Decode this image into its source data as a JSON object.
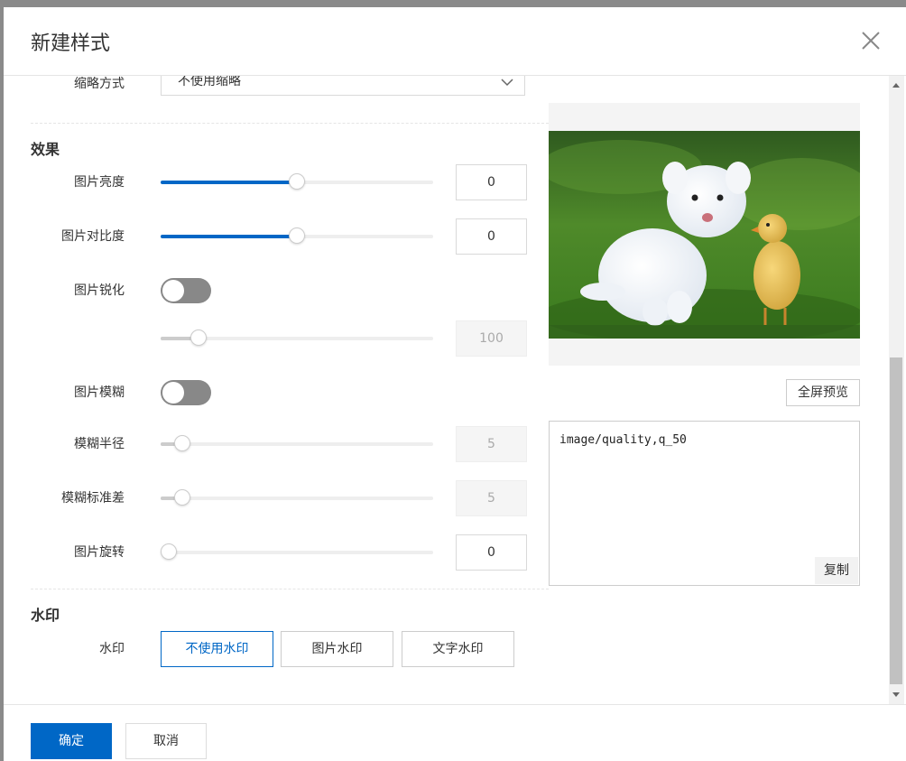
{
  "dialog": {
    "title": "新建样式"
  },
  "scale": {
    "label": "缩略方式",
    "value": "不使用缩略"
  },
  "effects": {
    "section_title": "效果",
    "brightness": {
      "label": "图片亮度",
      "value": "0",
      "level_percent": 50
    },
    "contrast": {
      "label": "图片对比度",
      "value": "0",
      "level_percent": 50
    },
    "sharpen": {
      "label": "图片锐化",
      "enabled": false,
      "value": "100",
      "level_percent": 14
    },
    "blur": {
      "label": "图片模糊",
      "enabled": false
    },
    "blur_radius": {
      "label": "模糊半径",
      "value": "5",
      "level_percent": 8
    },
    "blur_sigma": {
      "label": "模糊标准差",
      "value": "5",
      "level_percent": 8
    },
    "rotate": {
      "label": "图片旋转",
      "value": "0",
      "level_percent": 0
    }
  },
  "watermark": {
    "section_title": "水印",
    "label": "水印",
    "options": [
      "不使用水印",
      "图片水印",
      "文字水印"
    ],
    "selected": "不使用水印"
  },
  "preview": {
    "fullscreen_label": "全屏预览",
    "code": "image/quality,q_50",
    "copy_label": "复制"
  },
  "footer": {
    "ok_label": "确定",
    "cancel_label": "取消"
  },
  "colors": {
    "primary": "#0067c6",
    "toggle_off": "#888888"
  }
}
